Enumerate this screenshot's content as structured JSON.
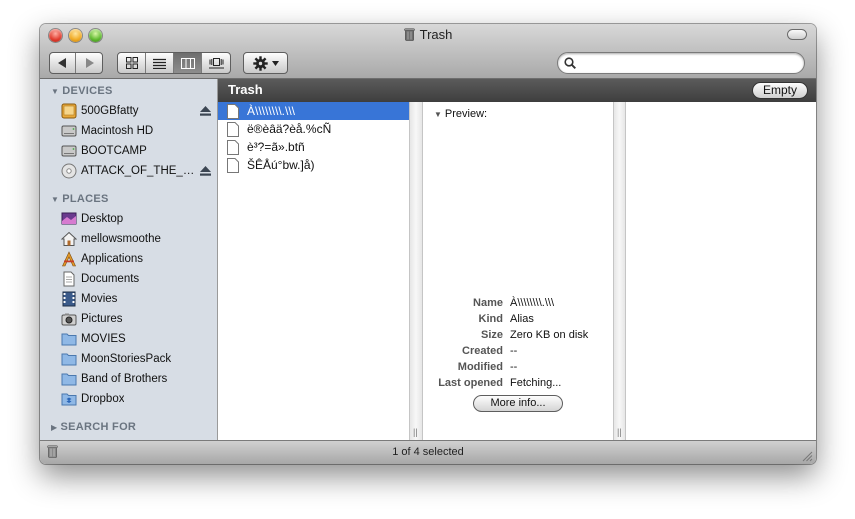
{
  "window": {
    "title": "Trash",
    "title_icon": "trash-icon"
  },
  "toolbar": {
    "back_icon": "back-arrow-icon",
    "forward_icon": "forward-arrow-icon",
    "views": [
      "icon-view",
      "list-view",
      "column-view",
      "cover-flow-view"
    ],
    "active_view": "column-view",
    "action_icon": "gear-icon",
    "search": {
      "value": "",
      "placeholder": ""
    }
  },
  "sidebar": {
    "devices_header": "DEVICES",
    "devices": [
      {
        "label": "500GBfatty",
        "icon": "external-drive-icon",
        "eject": true
      },
      {
        "label": "Macintosh HD",
        "icon": "internal-drive-icon",
        "eject": false
      },
      {
        "label": "BOOTCAMP",
        "icon": "internal-drive-icon",
        "eject": false
      },
      {
        "label": "ATTACK_OF_THE_C...",
        "icon": "optical-disc-icon",
        "eject": true
      }
    ],
    "places_header": "PLACES",
    "places": [
      {
        "label": "Desktop",
        "icon": "desktop-icon"
      },
      {
        "label": "mellowsmoothe",
        "icon": "home-icon"
      },
      {
        "label": "Applications",
        "icon": "applications-icon"
      },
      {
        "label": "Documents",
        "icon": "documents-icon"
      },
      {
        "label": "Movies",
        "icon": "movies-icon"
      },
      {
        "label": "Pictures",
        "icon": "pictures-icon"
      },
      {
        "label": "MOVIES",
        "icon": "folder-icon"
      },
      {
        "label": "MoonStoriesPack",
        "icon": "folder-icon"
      },
      {
        "label": "Band of Brothers",
        "icon": "folder-icon"
      },
      {
        "label": "Dropbox",
        "icon": "dropbox-folder-icon"
      }
    ],
    "search_header": "SEARCH FOR"
  },
  "pathbar": {
    "title": "Trash",
    "empty_label": "Empty"
  },
  "files": [
    {
      "name": "À\\\\\\\\\\\\\\\\.\\\\\\",
      "selected": true
    },
    {
      "name": "ë®èâä?èå.%cÑ",
      "selected": false
    },
    {
      "name": "è³?=ã».btñ",
      "selected": false
    },
    {
      "name": "ŠÊÅú°bw.]å)",
      "selected": false
    }
  ],
  "preview": {
    "label": "Preview:",
    "rows": [
      {
        "key": "Name",
        "value": "À\\\\\\\\\\\\\\\\.\\\\\\"
      },
      {
        "key": "Kind",
        "value": "Alias"
      },
      {
        "key": "Size",
        "value": "Zero KB on disk"
      },
      {
        "key": "Created",
        "value": "--"
      },
      {
        "key": "Modified",
        "value": "--"
      },
      {
        "key": "Last opened",
        "value": "Fetching..."
      }
    ],
    "more_info_label": "More info..."
  },
  "status": {
    "text": "1 of 4 selected"
  },
  "colors": {
    "selection": "#3875d7",
    "sidebar_bg": "#d7dde5",
    "pathbar_bg": "#4a4a4a"
  }
}
